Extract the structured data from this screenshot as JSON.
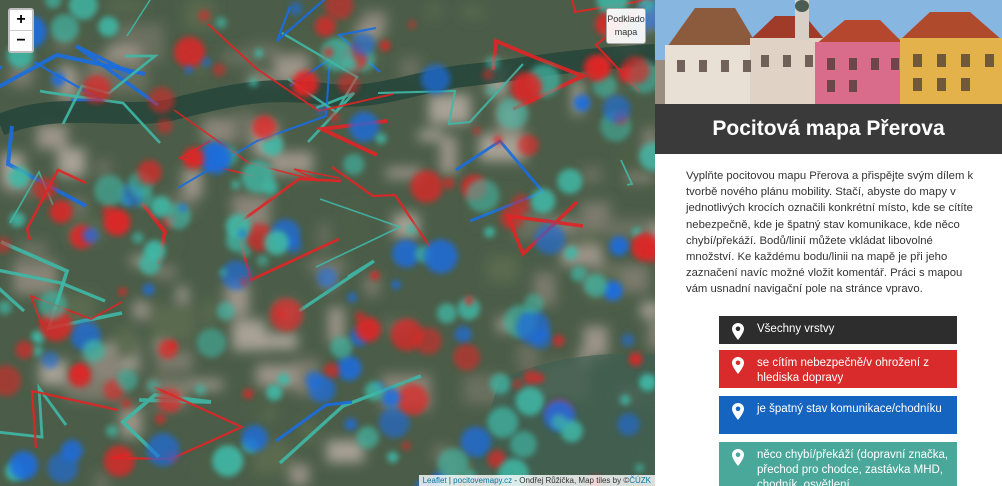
{
  "map": {
    "zoom_in": "+",
    "zoom_out": "−",
    "layers_label_1": "Podklado",
    "layers_label_2": "mapa",
    "attribution_leaflet": "Leaflet",
    "attribution_sep": " | ",
    "attribution_site": "pocitovemapy.cz",
    "attribution_rest": " - Ondřej Růžička, Map tiles by ©",
    "attribution_cuzk": "ČÚZK",
    "colors": {
      "danger": "#e02525",
      "bad_surface": "#1a6de0",
      "missing": "#3fb8a6"
    }
  },
  "panel": {
    "title": "Pocitová mapa Přerova",
    "description": "Vyplňte pocitovou mapu Přerova a přispějte svým dílem k tvorbě nového plánu mobility. Stačí, abyste do mapy v jednotlivých krocích označili konkrétní místo, kde se cítíte nebezpečně, kde je špatný stav komunikace, kde něco chybí/překáží. Bodů/linií můžete vkládat libovolné množství. Ke každému bodu/linii na mapě je při jeho zaznačení navíc možné vložit komentář. Práci s mapou vám usnadní navigační pole na stránce vpravo.",
    "buttons": {
      "all": "Všechny vrstvy",
      "danger": "se cítím nebezpečně/v ohrožení z hlediska dopravy",
      "surface": "je špatný stav komunikace/chodníku",
      "missing": "něco chybí/překáží (dopravní značka, přechod pro chodce, zastávka MHD, chodník, osvětlení,"
    }
  }
}
